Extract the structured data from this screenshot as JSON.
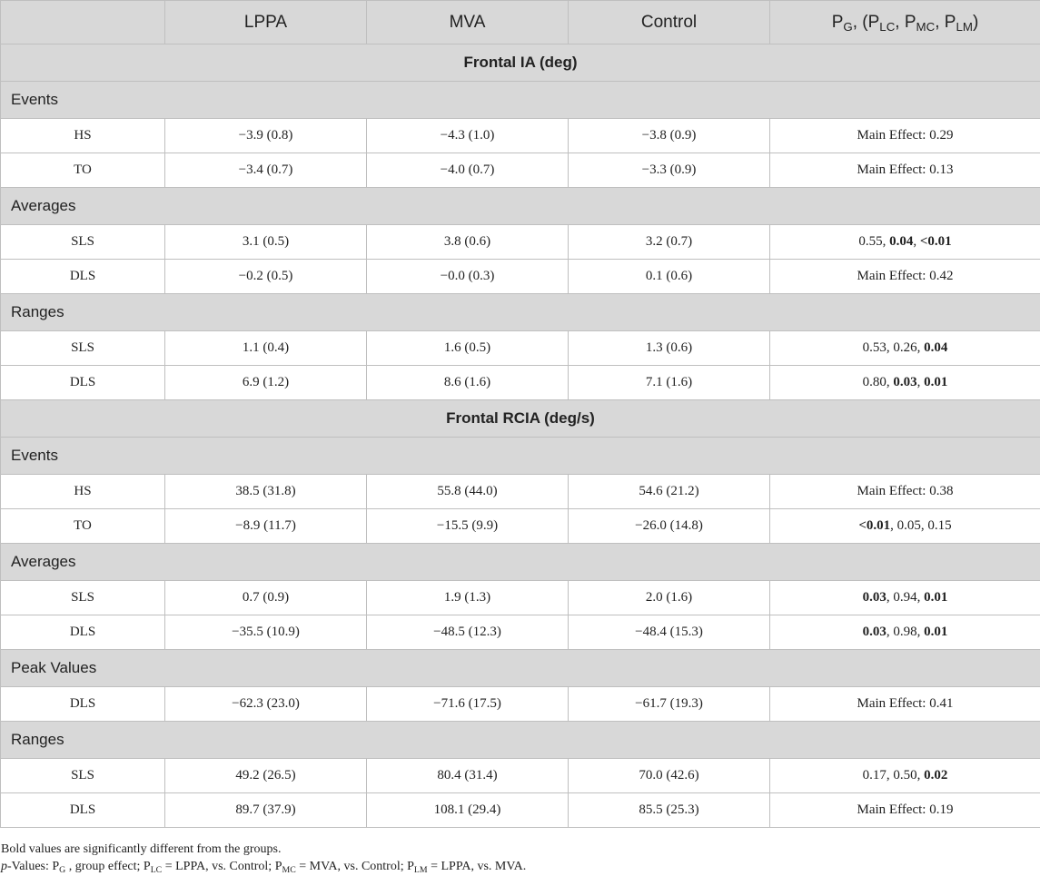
{
  "header": {
    "col_lppa": "LPPA",
    "col_mva": "MVA",
    "col_control": "Control",
    "col_p": {
      "p": "P",
      "g_sub": "G",
      "sep1": ", (",
      "lc_sub": "LC",
      "sep2": ", ",
      "mc_sub": "MC",
      "sep3": ", ",
      "lm_sub": "LM",
      "close": ")"
    }
  },
  "sections": [
    {
      "title": "Frontal IA (deg)",
      "groups": [
        {
          "label": "Events",
          "rows": [
            {
              "name": "HS",
              "lppa": "−3.9 (0.8)",
              "mva": "−4.3 (1.0)",
              "control": "−3.8 (0.9)",
              "p": [
                {
                  "t": "Main Effect: 0.29",
                  "b": false
                }
              ]
            },
            {
              "name": "TO",
              "lppa": "−3.4 (0.7)",
              "mva": "−4.0 (0.7)",
              "control": "−3.3 (0.9)",
              "p": [
                {
                  "t": "Main Effect: 0.13",
                  "b": false
                }
              ]
            }
          ]
        },
        {
          "label": "Averages",
          "rows": [
            {
              "name": "SLS",
              "lppa": "3.1 (0.5)",
              "mva": "3.8 (0.6)",
              "control": "3.2 (0.7)",
              "p": [
                {
                  "t": "0.55, ",
                  "b": false
                },
                {
                  "t": "0.04",
                  "b": true
                },
                {
                  "t": ", ",
                  "b": false
                },
                {
                  "t": "<0.01",
                  "b": true
                }
              ]
            },
            {
              "name": "DLS",
              "lppa": "−0.2 (0.5)",
              "mva": "−0.0 (0.3)",
              "control": "0.1 (0.6)",
              "p": [
                {
                  "t": "Main Effect: 0.42",
                  "b": false
                }
              ]
            }
          ]
        },
        {
          "label": "Ranges",
          "rows": [
            {
              "name": "SLS",
              "lppa": "1.1 (0.4)",
              "mva": "1.6 (0.5)",
              "control": "1.3 (0.6)",
              "p": [
                {
                  "t": "0.53, 0.26, ",
                  "b": false
                },
                {
                  "t": "0.04",
                  "b": true
                }
              ]
            },
            {
              "name": "DLS",
              "lppa": "6.9 (1.2)",
              "mva": "8.6 (1.6)",
              "control": "7.1 (1.6)",
              "p": [
                {
                  "t": "0.80, ",
                  "b": false
                },
                {
                  "t": "0.03",
                  "b": true
                },
                {
                  "t": ", ",
                  "b": false
                },
                {
                  "t": "0.01",
                  "b": true
                }
              ]
            }
          ]
        }
      ]
    },
    {
      "title": "Frontal RCIA (deg/s)",
      "groups": [
        {
          "label": "Events",
          "rows": [
            {
              "name": "HS",
              "lppa": "38.5 (31.8)",
              "mva": "55.8 (44.0)",
              "control": "54.6 (21.2)",
              "p": [
                {
                  "t": "Main Effect: 0.38",
                  "b": false
                }
              ]
            },
            {
              "name": "TO",
              "lppa": "−8.9 (11.7)",
              "mva": "−15.5 (9.9)",
              "control": "−26.0 (14.8)",
              "p": [
                {
                  "t": "<0.01",
                  "b": true
                },
                {
                  "t": ", 0.05, 0.15",
                  "b": false
                }
              ]
            }
          ]
        },
        {
          "label": "Averages",
          "rows": [
            {
              "name": "SLS",
              "lppa": "0.7 (0.9)",
              "mva": "1.9 (1.3)",
              "control": "2.0 (1.6)",
              "p": [
                {
                  "t": "0.03",
                  "b": true
                },
                {
                  "t": ", 0.94, ",
                  "b": false
                },
                {
                  "t": "0.01",
                  "b": true
                }
              ]
            },
            {
              "name": "DLS",
              "lppa": "−35.5 (10.9)",
              "mva": "−48.5 (12.3)",
              "control": "−48.4 (15.3)",
              "p": [
                {
                  "t": "0.03",
                  "b": true
                },
                {
                  "t": ", 0.98, ",
                  "b": false
                },
                {
                  "t": "0.01",
                  "b": true
                }
              ]
            }
          ]
        },
        {
          "label": "Peak Values",
          "rows": [
            {
              "name": "DLS",
              "lppa": "−62.3 (23.0)",
              "mva": "−71.6 (17.5)",
              "control": "−61.7 (19.3)",
              "p": [
                {
                  "t": "Main Effect: 0.41",
                  "b": false
                }
              ]
            }
          ]
        },
        {
          "label": "Ranges",
          "rows": [
            {
              "name": "SLS",
              "lppa": "49.2 (26.5)",
              "mva": "80.4 (31.4)",
              "control": "70.0 (42.6)",
              "p": [
                {
                  "t": "0.17, 0.50, ",
                  "b": false
                },
                {
                  "t": "0.02",
                  "b": true
                }
              ]
            },
            {
              "name": "DLS",
              "lppa": "89.7 (37.9)",
              "mva": "108.1 (29.4)",
              "control": "85.5 (25.3)",
              "p": [
                {
                  "t": "Main Effect: 0.19",
                  "b": false
                }
              ]
            }
          ]
        }
      ]
    }
  ],
  "notes": {
    "line1": "Bold values are significantly different from the groups.",
    "line2": {
      "italic_p": "p",
      "prefix": "-Values: P",
      "g_sub": "G",
      "g_text": " , group effect; P",
      "lc_sub": "LC",
      "lc_text": " = LPPA, vs. Control; P",
      "mc_sub": "MC",
      "mc_text": " = MVA, vs. Control; P",
      "lm_sub": "LM",
      "lm_text": " = LPPA, vs. MVA."
    }
  }
}
